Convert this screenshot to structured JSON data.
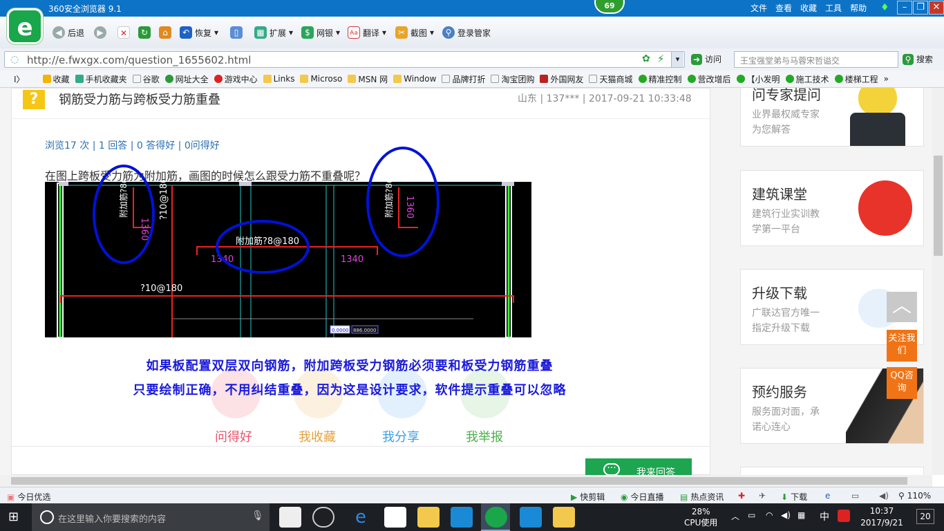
{
  "browser": {
    "title": "360安全浏览器 9.1",
    "badge": "69",
    "menu": [
      "文件",
      "查看",
      "收藏",
      "工具",
      "帮助"
    ],
    "logo": "e"
  },
  "toolbar": {
    "back": "后退",
    "restore": "恢复",
    "extend": "扩展",
    "bank": "网银",
    "translate": "翻译",
    "screenshot": "截图",
    "login": "登录管家"
  },
  "address": {
    "url": "http://e.fwxgx.com/question_1655602.html",
    "visit": "访问",
    "search_placeholder": "王宝强堂弟与马蓉宋哲谥交",
    "search_button": "搜索"
  },
  "bookmarks": [
    "收藏",
    "手机收藏夹",
    "谷歌",
    "网址大全",
    "游戏中心",
    "Links",
    "Microso",
    "MSN 网",
    "Window",
    "品牌打折",
    "淘宝团购",
    "外国网友",
    "天猫商城",
    "精准控制",
    "营改增后",
    "【小发明",
    "施工技术",
    "楼梯工程"
  ],
  "question": {
    "icon": "?",
    "title": "钢筋受力筋与跨板受力筋重叠",
    "meta": "山东 | 137*** | 2017-09-21 10:33:48",
    "stats": "浏览17 次 | 1 回答 | 0 答得好 | 0问得好",
    "text": "在图上跨板受力筋为附加筋，画图的时候怎么跟受力筋不重叠呢？"
  },
  "cad": {
    "labels": [
      "附加筋?8@0",
      "1360",
      "?10@180",
      "附加筋?8@180",
      "1340",
      "1340",
      "附加筋?8@",
      "1360",
      "?10@180",
      "0.0000",
      "886.0000"
    ]
  },
  "answer": {
    "line1": "如果板配置双层双向钢筋，附加跨板受力钢筋必须要和板受力钢筋重叠",
    "line2": "只要绘制正确，不用纠结重叠，因为这是设计要求，软件提示重叠可以忽略"
  },
  "actions": [
    {
      "label": "问得好",
      "color": "#e9546b"
    },
    {
      "label": "我收藏",
      "color": "#e5a13a"
    },
    {
      "label": "我分享",
      "color": "#3a9ee5"
    },
    {
      "label": "我举报",
      "color": "#4cae4c"
    }
  ],
  "answer_button": "我来回答",
  "sidebar": [
    {
      "title": "问专家提问",
      "sub1": "业界最权威专家",
      "sub2": "为您解答"
    },
    {
      "title": "建筑课堂",
      "sub1": "建筑行业实训教",
      "sub2": "学第一平台"
    },
    {
      "title": "升级下载",
      "sub1": "广联达官方唯一",
      "sub2": "指定升级下载"
    },
    {
      "title": "预约服务",
      "sub1": "服务面对面，承",
      "sub2": "诺心连心"
    }
  ],
  "float": {
    "top": "︿",
    "follow": "关注我们",
    "qq": "QQ咨询"
  },
  "status": {
    "left": "今日优选",
    "items": [
      "快剪辑",
      "今日直播",
      "热点资讯",
      "下载"
    ],
    "zoom": "110%"
  },
  "taskbar": {
    "search_placeholder": "在这里输入你要搜索的内容",
    "cpu": "28%",
    "cpu_label": "CPU使用",
    "ime": "中",
    "time": "10:37",
    "date": "2017/9/21",
    "notify": "20"
  }
}
